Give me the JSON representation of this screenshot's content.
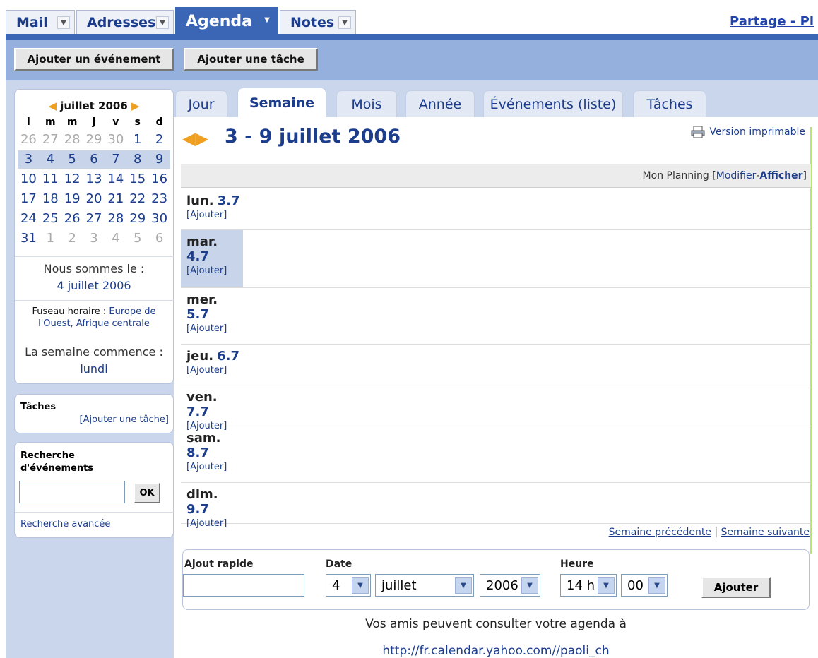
{
  "app_tabs": [
    {
      "label": "Mail"
    },
    {
      "label": "Adresses"
    },
    {
      "label": "Agenda"
    },
    {
      "label": "Notes"
    }
  ],
  "top_right_link": "Partage - Pl",
  "toolbar": {
    "add_event": "Ajouter un événement",
    "add_task": "Ajouter une tâche"
  },
  "mini_calendar": {
    "month_label": "juillet 2006",
    "weekdays": [
      "l",
      "m",
      "m",
      "j",
      "v",
      "s",
      "d"
    ],
    "weeks": [
      [
        "26",
        "27",
        "28",
        "29",
        "30",
        "1",
        "2"
      ],
      [
        "3",
        "4",
        "5",
        "6",
        "7",
        "8",
        "9"
      ],
      [
        "10",
        "11",
        "12",
        "13",
        "14",
        "15",
        "16"
      ],
      [
        "17",
        "18",
        "19",
        "20",
        "21",
        "22",
        "23"
      ],
      [
        "24",
        "25",
        "26",
        "27",
        "28",
        "29",
        "30"
      ],
      [
        "31",
        "1",
        "2",
        "3",
        "4",
        "5",
        "6"
      ]
    ],
    "today_label": "Nous sommes le :",
    "today_date": "4 juillet 2006",
    "tz_label": "Fuseau horaire :",
    "tz_value": "Europe de l'Ouest, Afrique centrale",
    "week_start_label": "La semaine commence :",
    "week_start_value": "lundi"
  },
  "tasks_panel": {
    "title": "Tâches",
    "add_link": "[Ajouter une tâche]"
  },
  "search_panel": {
    "title": "Recherche d'événements",
    "ok": "OK",
    "advanced": "Recherche avancée"
  },
  "view_tabs": [
    {
      "label": "Jour"
    },
    {
      "label": "Semaine"
    },
    {
      "label": "Mois"
    },
    {
      "label": "Année"
    },
    {
      "label": "Événements (liste)"
    },
    {
      "label": "Tâches"
    }
  ],
  "week_title": "3 - 9 juillet 2006",
  "print_link": "Version imprimable",
  "planning": {
    "label": "Mon Planning [",
    "modify": "Modifier",
    "sep": " - ",
    "show": "Afficher",
    "close": " ]"
  },
  "days": [
    {
      "name": "lun.",
      "num": "3.7",
      "add": "[Ajouter]"
    },
    {
      "name": "mar.",
      "num": "4.7",
      "add": "[Ajouter]"
    },
    {
      "name": "mer.",
      "num": "5.7",
      "add": "[Ajouter]"
    },
    {
      "name": "jeu.",
      "num": "6.7",
      "add": "[Ajouter]"
    },
    {
      "name": "ven.",
      "num": "7.7",
      "add": "[Ajouter]"
    },
    {
      "name": "sam.",
      "num": "8.7",
      "add": "[Ajouter]"
    },
    {
      "name": "dim.",
      "num": "9.7",
      "add": "[Ajouter]"
    }
  ],
  "week_nav": {
    "prev": "Semaine précédente",
    "sep": " | ",
    "next": "Semaine suivante"
  },
  "quick_add": {
    "label": "Ajout rapide",
    "value": "",
    "date_label": "Date",
    "day": "4",
    "month": "juillet",
    "year": "2006",
    "time_label": "Heure",
    "hour": "14 h",
    "minute": "00",
    "button": "Ajouter"
  },
  "share_text": "Vos amis peuvent consulter votre agenda à",
  "share_url": "http://fr.calendar.yahoo.com//paoli_ch",
  "colors": {
    "accent": "#3a66b5",
    "sidebar": "#c9d6ec",
    "link": "#1c3d8c",
    "arrow": "#f0a020"
  }
}
